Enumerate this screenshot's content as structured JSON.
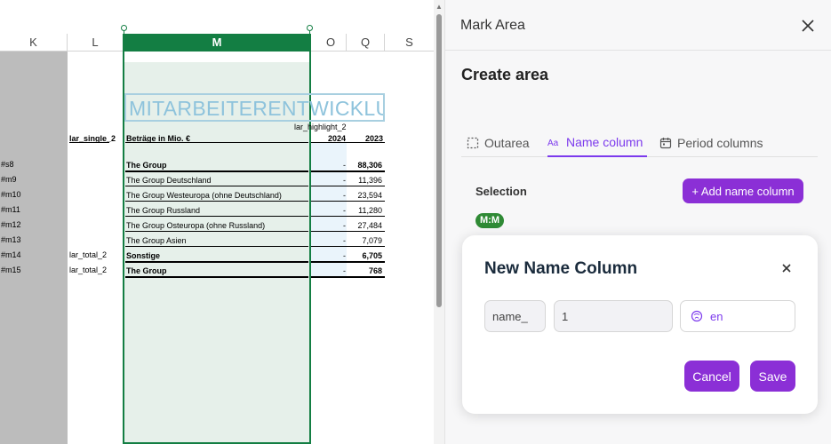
{
  "sheet": {
    "columns": [
      "K",
      "L",
      "M",
      "O",
      "Q",
      "S"
    ],
    "title_text": "MITARBEITERENTWICKLU",
    "highlight_label": "lar_highlight_2",
    "header_left": "lar_single_2",
    "header_caption": "Beträge in Mio. €",
    "year_1": "2024",
    "year_2": "2023",
    "rows": [
      {
        "id": "#s8",
        "klabel": "",
        "label": "The Group",
        "bold": true,
        "v1": "-",
        "v2": "88,306"
      },
      {
        "id": "#m9",
        "klabel": "",
        "label": "The Group Deutschland",
        "bold": false,
        "v1": "-",
        "v2": "11,396"
      },
      {
        "id": "#m10",
        "klabel": "",
        "label": "The Group Westeuropa (ohne Deutschland)",
        "bold": false,
        "v1": "-",
        "v2": "23,594"
      },
      {
        "id": "#m11",
        "klabel": "",
        "label": "The Group Russland",
        "bold": false,
        "v1": "-",
        "v2": "11,280"
      },
      {
        "id": "#m12",
        "klabel": "",
        "label": "The Group Osteuropa (ohne Russland)",
        "bold": false,
        "v1": "-",
        "v2": "27,484"
      },
      {
        "id": "#m13",
        "klabel": "",
        "label": "The Group Asien",
        "bold": false,
        "v1": "-",
        "v2": "7,079"
      },
      {
        "id": "#m14",
        "klabel": "lar_total_2",
        "label": "Sonstige",
        "bold": true,
        "v1": "-",
        "v2": "6,705"
      },
      {
        "id": "#m15",
        "klabel": "lar_total_2",
        "label": "The Group",
        "bold": true,
        "v1": "-",
        "v2": "768"
      }
    ]
  },
  "panel": {
    "title": "Mark Area",
    "create_title": "Create area",
    "tabs": [
      {
        "label": "Outarea",
        "icon": "dashed-square-icon"
      },
      {
        "label": "Name column",
        "icon": "text-aa-icon"
      },
      {
        "label": "Period columns",
        "icon": "calendar-icon"
      }
    ],
    "active_tab": "Name column",
    "selection_label": "Selection",
    "add_button": "+ Add name column",
    "selection_badge": "M:M",
    "dialog": {
      "title": "New Name Column",
      "prefix_value": "name_",
      "number_value": "1",
      "language_value": "en",
      "cancel": "Cancel",
      "save": "Save"
    }
  },
  "colors": {
    "accent": "#8b2fd6",
    "selection_green": "#137e43",
    "badge_green": "#2f8a35"
  }
}
